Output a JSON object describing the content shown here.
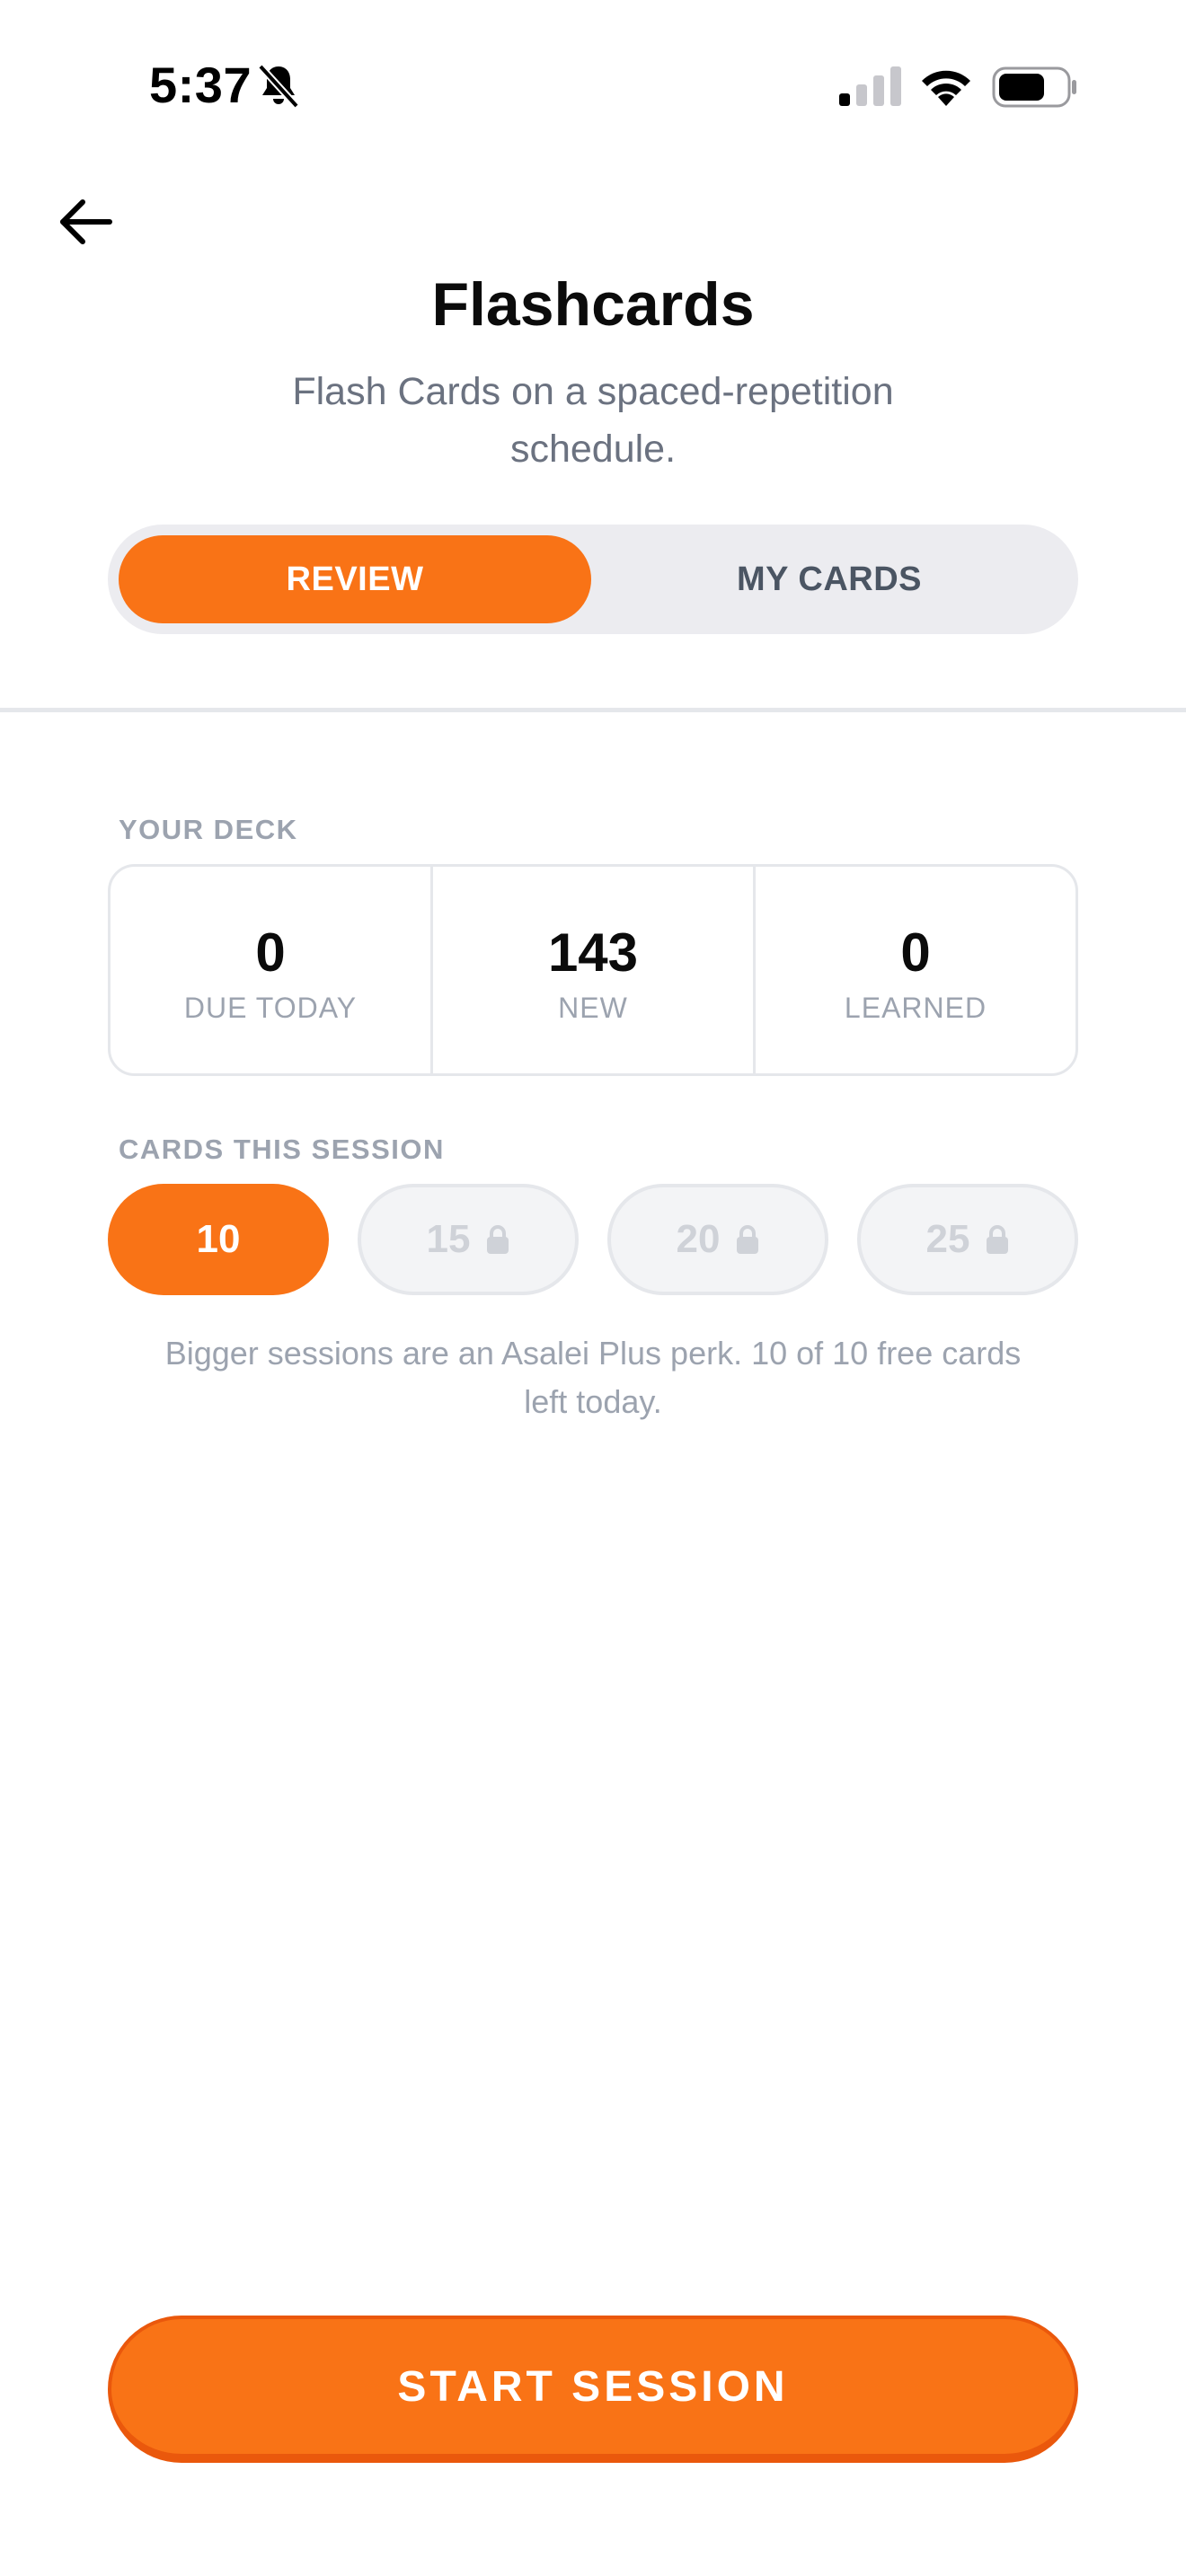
{
  "status_bar": {
    "time": "5:37"
  },
  "header": {
    "title": "Flashcards",
    "subtitle": "Flash Cards on a spaced-repetition schedule."
  },
  "tabs": [
    {
      "label": "REVIEW",
      "active": true
    },
    {
      "label": "MY CARDS",
      "active": false
    }
  ],
  "deck": {
    "label": "YOUR DECK",
    "stats": [
      {
        "value": "0",
        "label": "DUE TODAY"
      },
      {
        "value": "143",
        "label": "NEW"
      },
      {
        "value": "0",
        "label": "LEARNED"
      }
    ]
  },
  "session": {
    "label": "CARDS THIS SESSION",
    "options": [
      {
        "value": "10",
        "selected": true,
        "locked": false
      },
      {
        "value": "15",
        "selected": false,
        "locked": true
      },
      {
        "value": "20",
        "selected": false,
        "locked": true
      },
      {
        "value": "25",
        "selected": false,
        "locked": true
      }
    ],
    "note": "Bigger sessions are an Asalei Plus perk. 10 of 10 free cards left today."
  },
  "start_button": {
    "label": "START SESSION"
  },
  "colors": {
    "accent": "#f97316",
    "accent_dark": "#ea580c",
    "muted_text": "#9ca3af",
    "segment_bg": "#ececf0"
  },
  "icons": [
    "muted-bell-icon",
    "signal-icon",
    "wifi-icon",
    "battery-icon",
    "back-arrow-icon",
    "lock-icon"
  ]
}
